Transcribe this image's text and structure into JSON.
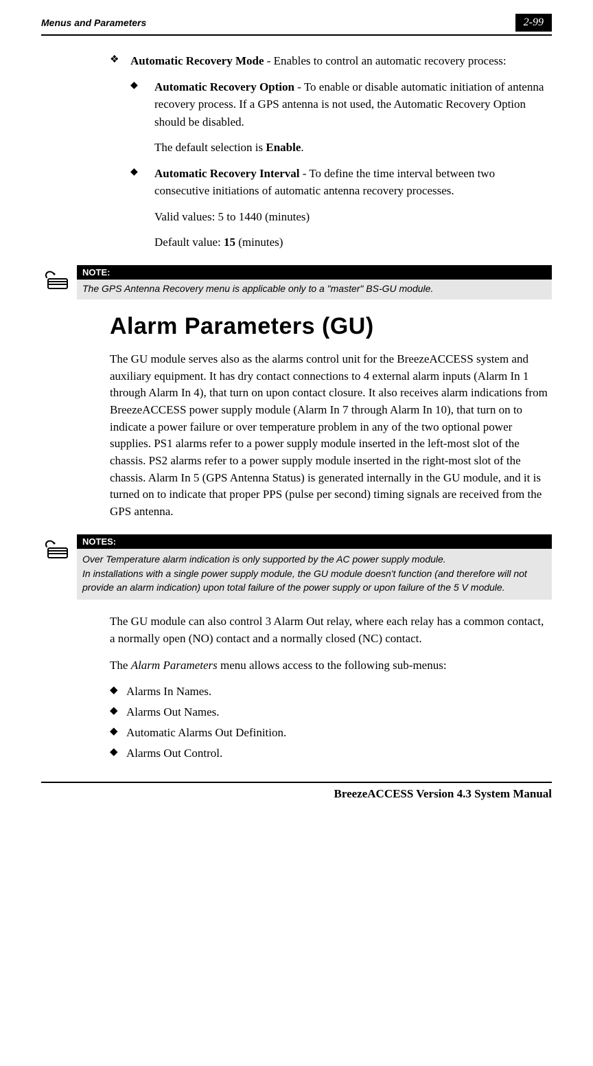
{
  "header": {
    "left": "Menus and Parameters",
    "right": "2-99"
  },
  "body": {
    "autoRecovery": {
      "title": "Automatic Recovery Mode",
      "titleTail": " - Enables to control an automatic recovery process:",
      "option": {
        "title": "Automatic Recovery Option",
        "titleTail": " - To enable or disable automatic initiation of antenna recovery process. If a GPS antenna is not used, the Automatic Recovery Option should be disabled.",
        "defaultLine": "The default selection is ",
        "defaultValue": "Enable",
        "defaultTail": "."
      },
      "interval": {
        "title": "Automatic Recovery Interval",
        "titleTail": " - To define the time interval between two consecutive initiations of automatic antenna recovery processes.",
        "validLine": "Valid values: 5 to 1440 (minutes)",
        "defaultLine": "Default value: ",
        "defaultValue": "15",
        "defaultTail": " (minutes)"
      }
    },
    "note1": {
      "header": "NOTE:",
      "body": "The GPS Antenna Recovery menu is applicable only to a \"master\" BS-GU module."
    },
    "sectionTitle": "Alarm Parameters (GU)",
    "para1": "The GU module serves also as the alarms control unit for the BreezeACCESS system and auxiliary equipment. It has dry contact connections to 4 external alarm inputs (Alarm In 1 through Alarm In 4), that turn on upon contact closure. It also receives alarm indications from BreezeACCESS power supply module (Alarm In 7 through Alarm In 10), that turn on to indicate a power failure or over temperature problem in any of the two optional power supplies. PS1 alarms refer to a power supply module inserted in the left-most slot of the chassis. PS2 alarms refer to a power supply module inserted in the right-most slot of the chassis. Alarm In 5 (GPS Antenna Status) is generated internally in the GU module, and it is turned on to indicate that proper PPS (pulse per second) timing signals are received from the GPS antenna.",
    "note2": {
      "header": "NOTES:",
      "body1": "Over Temperature alarm indication is only supported by the AC power supply module.",
      "body2": "In installations with a single power supply module, the GU module doesn't function (and therefore will not provide an alarm indication) upon total failure of the power supply or upon failure of the 5 V module."
    },
    "para2": "The GU module can also control 3 Alarm Out relay, where each relay has a common contact, a normally open (NO) contact and a normally closed (NC) contact.",
    "para3pre": "The ",
    "para3italic": "Alarm Parameters",
    "para3post": " menu allows access to the following sub-menus:",
    "submenus": [
      "Alarms In Names.",
      "Alarms Out Names.",
      "Automatic Alarms Out Definition.",
      "Alarms Out Control."
    ]
  },
  "footer": "BreezeACCESS Version 4.3 System Manual"
}
